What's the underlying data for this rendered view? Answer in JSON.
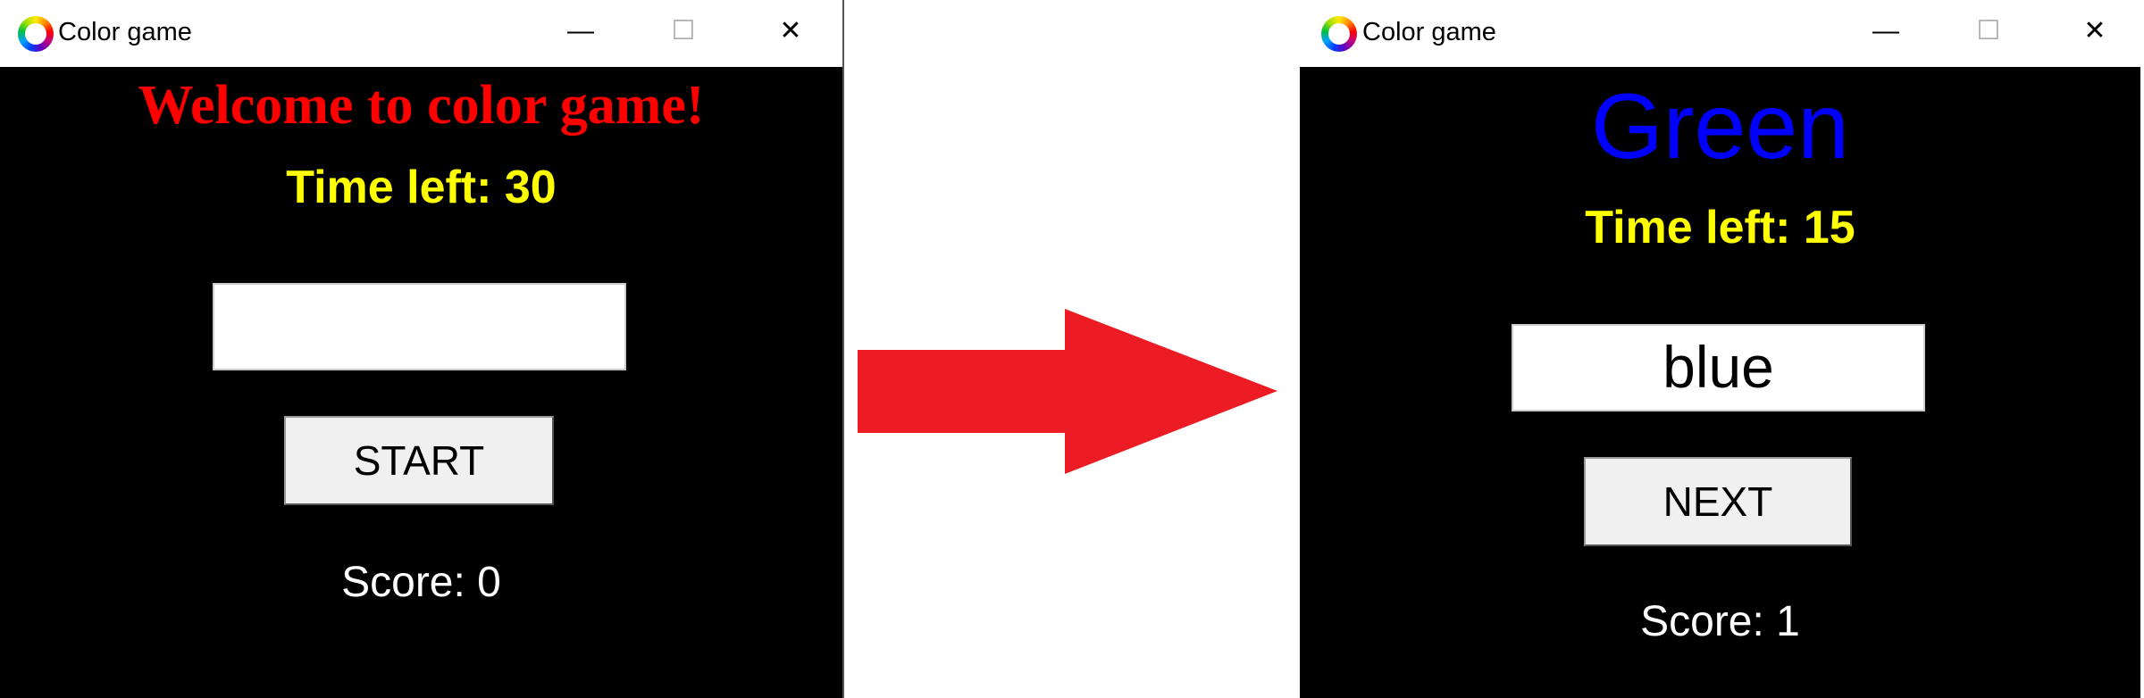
{
  "before": {
    "window_title": "Color game",
    "heading": "Welcome to color game!",
    "heading_color": "#ff0000",
    "time_left": "Time left: 30",
    "entry_value": "",
    "button_label": "START",
    "score": "Score: 0"
  },
  "after": {
    "window_title": "Color game",
    "heading": "Green",
    "heading_color": "#0000ff",
    "time_left": "Time left: 15",
    "entry_value": "blue",
    "button_label": "NEXT",
    "score": "Score: 1"
  },
  "controls": {
    "minimize": "—",
    "maximize": "☐",
    "close": "✕"
  },
  "colors": {
    "arrow": "#ed1c24",
    "time_text": "#ffff00",
    "score_text": "#ffffff"
  }
}
